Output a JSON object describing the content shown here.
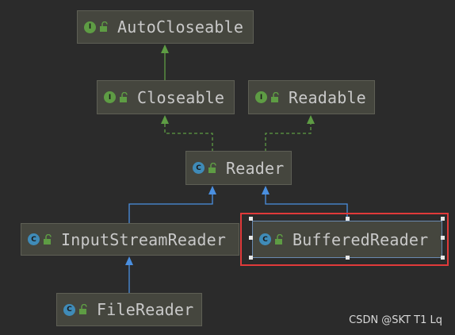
{
  "nodes": [
    {
      "id": "autocloseable",
      "label": "AutoCloseable",
      "kind": "interface",
      "badge": "I"
    },
    {
      "id": "closeable",
      "label": "Closeable",
      "kind": "interface",
      "badge": "I"
    },
    {
      "id": "readable",
      "label": "Readable",
      "kind": "interface",
      "badge": "I"
    },
    {
      "id": "reader",
      "label": "Reader",
      "kind": "class",
      "badge": "C"
    },
    {
      "id": "inputstreamreader",
      "label": "InputStreamReader",
      "kind": "class",
      "badge": "C"
    },
    {
      "id": "bufferedreader",
      "label": "BufferedReader",
      "kind": "class",
      "badge": "C",
      "selected": true
    },
    {
      "id": "filereader",
      "label": "FileReader",
      "kind": "class",
      "badge": "C"
    }
  ],
  "edges": [
    {
      "from": "closeable",
      "to": "autocloseable",
      "type": "extends"
    },
    {
      "from": "reader",
      "to": "closeable",
      "type": "implements"
    },
    {
      "from": "reader",
      "to": "readable",
      "type": "implements"
    },
    {
      "from": "inputstreamreader",
      "to": "reader",
      "type": "extends"
    },
    {
      "from": "bufferedreader",
      "to": "reader",
      "type": "extends"
    },
    {
      "from": "filereader",
      "to": "inputstreamreader",
      "type": "extends"
    }
  ],
  "colors": {
    "background": "#2b2b2b",
    "node_fill": "#45463e",
    "extends_interface": "#5e9c44",
    "extends_class": "#4a8fe0",
    "implements": "#5e9c44",
    "selection": "#e03a3a"
  },
  "watermark": "CSDN @SKT T1 Lq"
}
